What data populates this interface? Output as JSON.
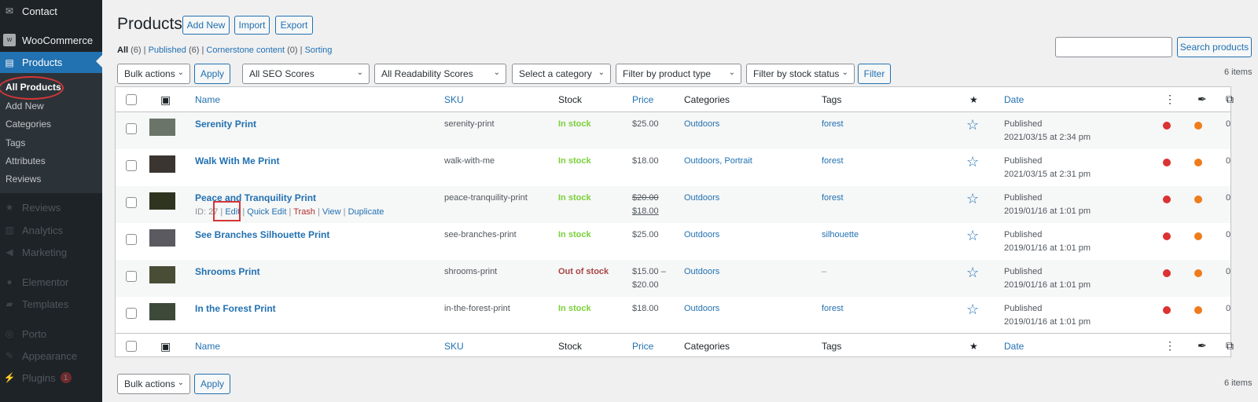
{
  "sidebar": {
    "contact": "Contact",
    "woocommerce": "WooCommerce",
    "products": "Products",
    "submenu": [
      "All Products",
      "Add New",
      "Categories",
      "Tags",
      "Attributes",
      "Reviews"
    ],
    "reviews": "Reviews",
    "analytics": "Analytics",
    "marketing": "Marketing",
    "elementor": "Elementor",
    "templates": "Templates",
    "porto": "Porto",
    "appearance": "Appearance",
    "plugins": "Plugins",
    "plugins_badge": "1"
  },
  "header": {
    "title": "Products",
    "add_new": "Add New",
    "import": "Import",
    "export": "Export"
  },
  "views": {
    "all": "All",
    "all_count": "(6)",
    "published": "Published",
    "published_count": "(6)",
    "cornerstone": "Cornerstone content",
    "cornerstone_count": "(0)",
    "sorting": "Sorting"
  },
  "search": {
    "button": "Search products",
    "value": ""
  },
  "filters": {
    "bulk": "Bulk actions",
    "apply": "Apply",
    "seo": "All SEO Scores",
    "readability": "All Readability Scores",
    "category": "Select a category",
    "product_type": "Filter by product type",
    "stock": "Filter by stock status",
    "filter": "Filter"
  },
  "items_count": "6 items",
  "columns": {
    "name": "Name",
    "sku": "SKU",
    "stock": "Stock",
    "price": "Price",
    "categories": "Categories",
    "tags": "Tags",
    "star": "★",
    "date": "Date"
  },
  "rows": [
    {
      "name": "Serenity Print",
      "sku": "serenity-print",
      "stock": "In stock",
      "price": "$25.00",
      "categories": "Outdoors",
      "tags": "forest",
      "status": "Published",
      "date": "2021/03/15 at 2:34 pm",
      "count": "0"
    },
    {
      "name": "Walk With Me Print",
      "sku": "walk-with-me",
      "stock": "In stock",
      "price": "$18.00",
      "categories": "Outdoors, Portrait",
      "tags": "forest",
      "status": "Published",
      "date": "2021/03/15 at 2:31 pm",
      "count": "0"
    },
    {
      "name": "Peace and Tranquility Print",
      "sku": "peace-tranquility-print",
      "stock": "In stock",
      "price_old": "$20.00",
      "price": "$18.00",
      "categories": "Outdoors",
      "tags": "forest",
      "status": "Published",
      "date": "2019/01/16 at 1:01 pm",
      "count": "0",
      "row_actions": {
        "id": "ID: 27",
        "edit": "Edit",
        "quick_edit": "Quick Edit",
        "trash": "Trash",
        "view": "View",
        "duplicate": "Duplicate"
      }
    },
    {
      "name": "See Branches Silhouette Print",
      "sku": "see-branches-print",
      "stock": "In stock",
      "price": "$25.00",
      "categories": "Outdoors",
      "tags": "silhouette",
      "status": "Published",
      "date": "2019/01/16 at 1:01 pm",
      "count": "0"
    },
    {
      "name": "Shrooms Print",
      "sku": "shrooms-print",
      "stock": "Out of stock",
      "price": "$15.00 –",
      "price2": "$20.00",
      "categories": "Outdoors",
      "tags": "–",
      "status": "Published",
      "date": "2019/01/16 at 1:01 pm",
      "count": "0"
    },
    {
      "name": "In the Forest Print",
      "sku": "in-the-forest-print",
      "stock": "In stock",
      "price": "$18.00",
      "categories": "Outdoors",
      "tags": "forest",
      "status": "Published",
      "date": "2019/01/16 at 1:01 pm",
      "count": "0"
    }
  ],
  "colors": {
    "seo_dot": "#dc3232",
    "readability_dot": "#ee7c1b",
    "instock": "#7ad03a",
    "outstock": "#aa4444",
    "accent": "#2271b1"
  }
}
